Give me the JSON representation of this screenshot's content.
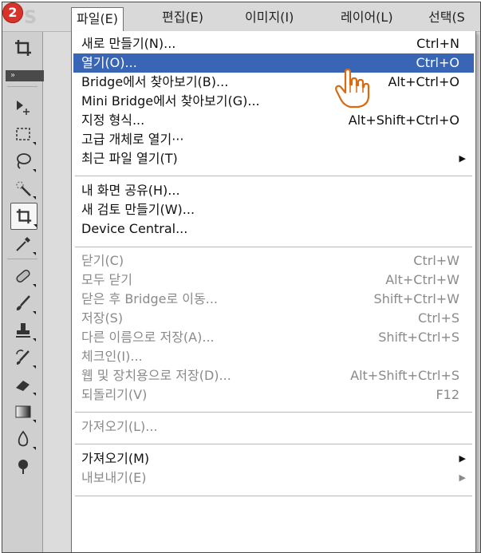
{
  "app": {
    "logo": "PS",
    "step_badge": "2"
  },
  "menubar": {
    "items": [
      {
        "label": "파일(E)",
        "active": true
      },
      {
        "label": "편집(E)"
      },
      {
        "label": "이미지(I)"
      },
      {
        "label": "레이어(L)"
      },
      {
        "label": "선택(S"
      }
    ]
  },
  "menu": {
    "items": [
      {
        "label": "새로 만들기(N)...",
        "shortcut": "Ctrl+N"
      },
      {
        "label": "열기(O)...",
        "shortcut": "Ctrl+O",
        "highlighted": true
      },
      {
        "label": "Bridge에서 찾아보기(B)...",
        "shortcut": "Alt+Ctrl+O"
      },
      {
        "label": "Mini Bridge에서 찾아보기(G)...",
        "shortcut": ""
      },
      {
        "label": "지정 형식...",
        "shortcut": "Alt+Shift+Ctrl+O"
      },
      {
        "label": "고급 개체로 열기···",
        "shortcut": ""
      },
      {
        "label": "최근 파일 열기(T)",
        "shortcut": "",
        "submenu": true
      },
      {
        "label": "내 화면 공유(H)...",
        "shortcut": ""
      },
      {
        "label": "새 검토 만들기(W)...",
        "shortcut": ""
      },
      {
        "label": "Device Central...",
        "shortcut": ""
      },
      {
        "label": "닫기(C)",
        "shortcut": "Ctrl+W",
        "disabled": true
      },
      {
        "label": "모두 닫기",
        "shortcut": "Alt+Ctrl+W",
        "disabled": true
      },
      {
        "label": "닫은 후 Bridge로 이동...",
        "shortcut": "Shift+Ctrl+W",
        "disabled": true
      },
      {
        "label": "저장(S)",
        "shortcut": "Ctrl+S",
        "disabled": true
      },
      {
        "label": "다른 이름으로 저장(A)...",
        "shortcut": "Shift+Ctrl+S",
        "disabled": true
      },
      {
        "label": "체크인(I)...",
        "shortcut": "",
        "disabled": true
      },
      {
        "label": "웹 및 장치용으로 저장(D)...",
        "shortcut": "Alt+Shift+Ctrl+S",
        "disabled": true
      },
      {
        "label": "되돌리기(V)",
        "shortcut": "F12",
        "disabled": true
      },
      {
        "label": "가져오기(L)...",
        "shortcut": "",
        "disabled": true
      },
      {
        "label": "가져오기(M)",
        "shortcut": "",
        "submenu": true
      },
      {
        "label": "내보내기(E)",
        "shortcut": "",
        "submenu": true,
        "disabled": true
      }
    ]
  },
  "toolbar": {
    "tools": [
      "move-tool",
      "marquee-tool",
      "lasso-tool",
      "magic-wand-tool",
      "crop-tool",
      "eyedropper-tool",
      "healing-brush-tool",
      "brush-tool",
      "clone-stamp-tool",
      "history-brush-tool",
      "eraser-tool",
      "gradient-tool",
      "blur-tool",
      "dodge-tool"
    ],
    "selected": "crop-tool"
  },
  "colors": {
    "highlight": "#3865b5",
    "disabled_text": "#8a8a8a",
    "badge": "#d8332a"
  }
}
